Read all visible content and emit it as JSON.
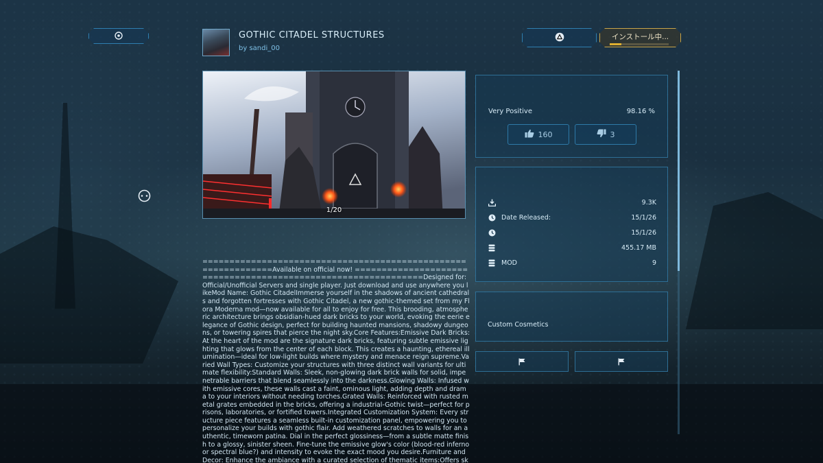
{
  "header": {
    "title": "GOTHIC CITADEL STRUCTURES",
    "author": "by sandi_00",
    "install_status": "インストール中...",
    "install_progress": 0.2
  },
  "icons": {
    "back": "circle-button-icon",
    "triangle": "triangle-button-icon",
    "cursor": "cursor-reticle-icon",
    "thumbs_up": "thumbs-up-icon",
    "thumbs_down": "thumbs-down-icon",
    "download": "download-icon",
    "clock": "clock-icon",
    "storage": "database-icon",
    "flag": "flag-icon"
  },
  "gallery": {
    "counter": "1/20"
  },
  "description": "==============================================================Available on official now! ==============================================================Designed for: Official/Unofficial Servers and single player. Just download and use anywhere you likeMod Name: Gothic CitadelImmerse yourself in the shadows of ancient cathedrals and forgotten fortresses with Gothic Citadel, a new gothic-themed set from my Flora Moderna mod—now available for all to enjoy for free. This brooding, atmospheric architecture brings obsidian-hued dark bricks to your world, evoking the eerie elegance of Gothic design, perfect for building haunted mansions, shadowy dungeons, or towering spires that pierce the night sky.Core Features:Emissive Dark Bricks: At the heart of the mod are the signature dark bricks, featuring subtle emissive lighting that glows from the center of each block. This creates a haunting, ethereal illumination—ideal for low-light builds where mystery and menace reign supreme.Varied Wall Types: Customize your structures with three distinct wall variants for ultimate flexibility:Standard Walls: Sleek, non-glowing dark brick walls for solid, impenetrable barriers that blend seamlessly into the darkness.Glowing Walls: Infused with emissive cores, these walls cast a faint, ominous light, adding depth and drama to your interiors without needing torches.Grated Walls: Reinforced with rusted metal grates embedded in the bricks, offering a industrial-Gothic twist—perfect for prisons, laboratories, or fortified towers.Integrated Customization System: Every structure piece features a seamless built-in customization panel, empowering you to personalize your builds with gothic flair. Add weathered scratches to walls for an authentic, timeworn patina. Dial in the perfect glossiness—from a subtle matte finish to a glossy, sinister sheen. Fine-tune the emissive glow's color (blood-red inferno or spectral blue?) and intensity to evoke the exact mood you desire.Furniture and Decor: Enhance the ambiance with a curated selection of thematic items:Offers skins for: Decor Box, Table, Storage box small, Fireplace, Transmitter, Chair, Bench, Flat pillar, Wall sign, Bookshelf, Rug, Single bed",
  "rating": {
    "label": "Very Positive",
    "percent": "98.16 %",
    "upvotes": "160",
    "downvotes": "3"
  },
  "stats": {
    "downloads": "9.3K",
    "date_released_label": "Date Released:",
    "date_released": "15/1/26",
    "date_updated": "15/1/26",
    "size": "455.17 MB",
    "mod_label": "MOD",
    "mod_count": "9"
  },
  "tags": {
    "category": "Custom Cosmetics"
  },
  "colors": {
    "accent": "#2f7fb0",
    "install_border": "#c9a54a",
    "install_fill": "#e0b030"
  }
}
